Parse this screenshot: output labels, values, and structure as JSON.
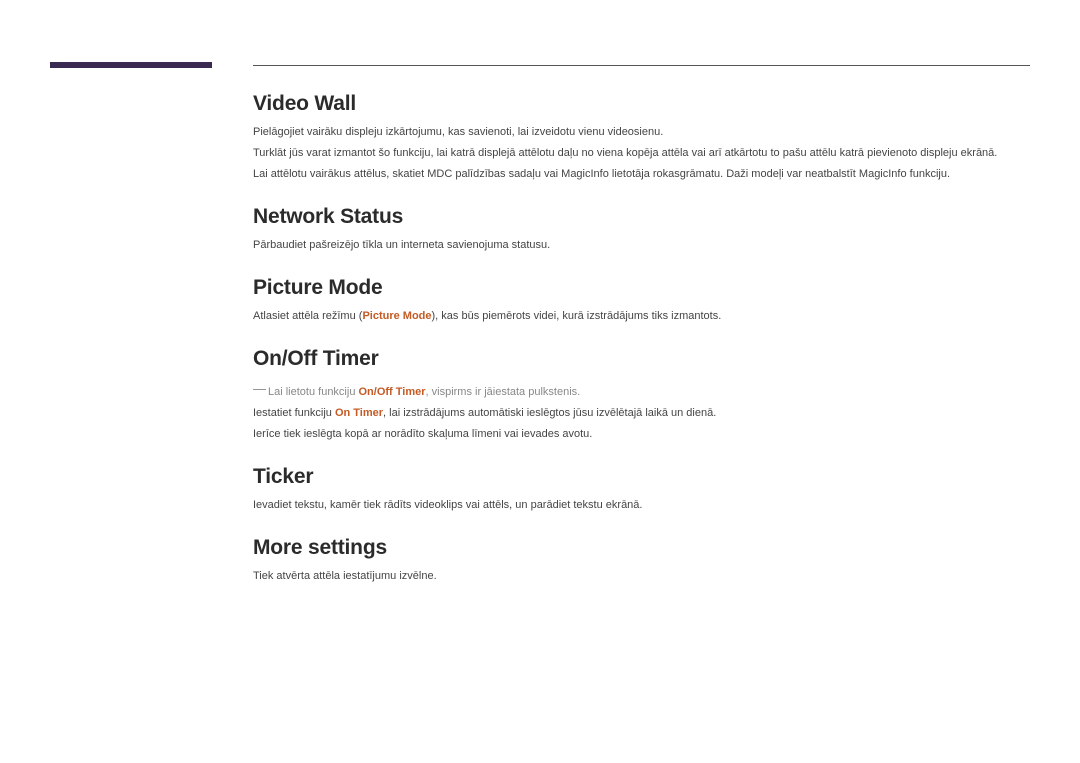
{
  "sections": {
    "videoWall": {
      "title": "Video Wall",
      "p1": "Pielāgojiet vairāku displeju izkārtojumu, kas savienoti, lai izveidotu vienu videosienu.",
      "p2": "Turklāt jūs varat izmantot šo funkciju, lai katrā displejā attēlotu daļu no viena kopēja attēla vai arī atkārtotu to pašu attēlu katrā pievienoto displeju ekrānā.",
      "p3": "Lai attēlotu vairākus attēlus, skatiet MDC palīdzības sadaļu vai MagicInfo lietotāja rokasgrāmatu. Daži modeļi var neatbalstīt MagicInfo funkciju."
    },
    "networkStatus": {
      "title": "Network Status",
      "p1": "Pārbaudiet pašreizējo tīkla un interneta savienojuma statusu."
    },
    "pictureMode": {
      "title": "Picture Mode",
      "before": "Atlasiet attēla režīmu (",
      "bold": "Picture Mode",
      "after": "), kas būs piemērots videi, kurā izstrādājums tiks izmantots."
    },
    "onOffTimer": {
      "title": "On/Off Timer",
      "noteBefore": "Lai lietotu funkciju ",
      "noteBold": "On/Off Timer",
      "noteAfter": ", vispirms ir jāiestata pulkstenis.",
      "p2before": "Iestatiet funkciju ",
      "p2bold": "On Timer",
      "p2after": ", lai izstrādājums automātiski ieslēgtos jūsu izvēlētajā laikā un dienā.",
      "p3": "Ierīce tiek ieslēgta kopā ar norādīto skaļuma līmeni vai ievades avotu."
    },
    "ticker": {
      "title": "Ticker",
      "p1": "Ievadiet tekstu, kamēr tiek rādīts videoklips vai attēls, un parādiet tekstu ekrānā."
    },
    "moreSettings": {
      "title": "More settings",
      "p1": "Tiek atvērta attēla iestatījumu izvēlne."
    }
  }
}
